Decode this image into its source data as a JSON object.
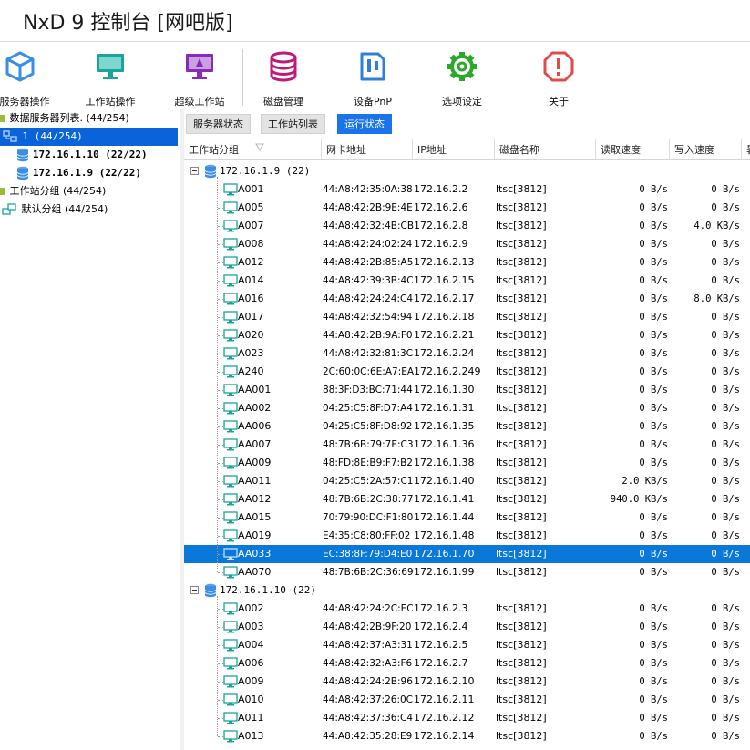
{
  "app": {
    "title": "NxD 9 控制台 [网吧版]"
  },
  "toolbar": {
    "server_ops": "服务器操作",
    "workstation_ops": "工作站操作",
    "super_workstation": "超级工作站",
    "disk_mgmt": "磁盘管理",
    "device_pnp": "设备PnP",
    "options": "选项设定",
    "about": "关于"
  },
  "left_tree": {
    "server_list": "数据服务器列表. (44/254)",
    "group1": "1 (44/254)",
    "server_a": "172.16.1.10 (22/22)",
    "server_b": "172.16.1.9 (22/22)",
    "ws_groups": "工作站分组 (44/254)",
    "default_group": "默认分组 (44/254)"
  },
  "tabs": {
    "server_status": "服务器状态",
    "ws_list": "工作站列表",
    "run_status": "运行状态"
  },
  "grid": {
    "columns": {
      "group": "工作站分组",
      "mac": "网卡地址",
      "ip": "IP地址",
      "disk": "磁盘名称",
      "read": "读取速度",
      "write": "写入速度",
      "extra": "暑"
    },
    "group1_label": "172.16.1.9 (22)",
    "group2_label": "172.16.1.10 (22)",
    "group1_rows": [
      {
        "name": "A001",
        "mac": "44:A8:42:35:0A:38",
        "ip": "172.16.2.2",
        "disk": "ltsc[3812]",
        "read": "0 B/s",
        "write": "0 B/s"
      },
      {
        "name": "A005",
        "mac": "44:A8:42:2B:9E:4E",
        "ip": "172.16.2.6",
        "disk": "ltsc[3812]",
        "read": "0 B/s",
        "write": "0 B/s"
      },
      {
        "name": "A007",
        "mac": "44:A8:42:32:4B:CB",
        "ip": "172.16.2.8",
        "disk": "ltsc[3812]",
        "read": "0 B/s",
        "write": "4.0 KB/s"
      },
      {
        "name": "A008",
        "mac": "44:A8:42:24:02:24",
        "ip": "172.16.2.9",
        "disk": "ltsc[3812]",
        "read": "0 B/s",
        "write": "0 B/s"
      },
      {
        "name": "A012",
        "mac": "44:A8:42:2B:85:A5",
        "ip": "172.16.2.13",
        "disk": "ltsc[3812]",
        "read": "0 B/s",
        "write": "0 B/s"
      },
      {
        "name": "A014",
        "mac": "44:A8:42:39:3B:4C",
        "ip": "172.16.2.15",
        "disk": "ltsc[3812]",
        "read": "0 B/s",
        "write": "0 B/s"
      },
      {
        "name": "A016",
        "mac": "44:A8:42:24:24:C4",
        "ip": "172.16.2.17",
        "disk": "ltsc[3812]",
        "read": "0 B/s",
        "write": "8.0 KB/s"
      },
      {
        "name": "A017",
        "mac": "44:A8:42:32:54:94",
        "ip": "172.16.2.18",
        "disk": "ltsc[3812]",
        "read": "0 B/s",
        "write": "0 B/s"
      },
      {
        "name": "A020",
        "mac": "44:A8:42:2B:9A:F0",
        "ip": "172.16.2.21",
        "disk": "ltsc[3812]",
        "read": "0 B/s",
        "write": "0 B/s"
      },
      {
        "name": "A023",
        "mac": "44:A8:42:32:81:3C",
        "ip": "172.16.2.24",
        "disk": "ltsc[3812]",
        "read": "0 B/s",
        "write": "0 B/s"
      },
      {
        "name": "A240",
        "mac": "2C:60:0C:6E:A7:EA",
        "ip": "172.16.2.249",
        "disk": "ltsc[3812]",
        "read": "0 B/s",
        "write": "0 B/s"
      },
      {
        "name": "AA001",
        "mac": "88:3F:D3:BC:71:44",
        "ip": "172.16.1.30",
        "disk": "ltsc[3812]",
        "read": "0 B/s",
        "write": "0 B/s"
      },
      {
        "name": "AA002",
        "mac": "04:25:C5:8F:D7:A4",
        "ip": "172.16.1.31",
        "disk": "ltsc[3812]",
        "read": "0 B/s",
        "write": "0 B/s"
      },
      {
        "name": "AA006",
        "mac": "04:25:C5:8F:D8:92",
        "ip": "172.16.1.35",
        "disk": "ltsc[3812]",
        "read": "0 B/s",
        "write": "0 B/s"
      },
      {
        "name": "AA007",
        "mac": "48:7B:6B:79:7E:C3",
        "ip": "172.16.1.36",
        "disk": "ltsc[3812]",
        "read": "0 B/s",
        "write": "0 B/s"
      },
      {
        "name": "AA009",
        "mac": "48:FD:8E:B9:F7:B2",
        "ip": "172.16.1.38",
        "disk": "ltsc[3812]",
        "read": "0 B/s",
        "write": "0 B/s"
      },
      {
        "name": "AA011",
        "mac": "04:25:C5:2A:57:C1",
        "ip": "172.16.1.40",
        "disk": "ltsc[3812]",
        "read": "2.0 KB/s",
        "write": "0 B/s"
      },
      {
        "name": "AA012",
        "mac": "48:7B:6B:2C:38:77",
        "ip": "172.16.1.41",
        "disk": "ltsc[3812]",
        "read": "940.0 KB/s",
        "write": "0 B/s"
      },
      {
        "name": "AA015",
        "mac": "70:79:90:DC:F1:80",
        "ip": "172.16.1.44",
        "disk": "ltsc[3812]",
        "read": "0 B/s",
        "write": "0 B/s"
      },
      {
        "name": "AA019",
        "mac": "E4:35:C8:80:FF:02",
        "ip": "172.16.1.48",
        "disk": "ltsc[3812]",
        "read": "0 B/s",
        "write": "0 B/s"
      },
      {
        "name": "AA033",
        "mac": "EC:38:8F:79:D4:E0",
        "ip": "172.16.1.70",
        "disk": "ltsc[3812]",
        "read": "0 B/s",
        "write": "0 B/s",
        "selected": true
      },
      {
        "name": "AA070",
        "mac": "48:7B:6B:2C:36:69",
        "ip": "172.16.1.99",
        "disk": "ltsc[3812]",
        "read": "0 B/s",
        "write": "0 B/s"
      }
    ],
    "group2_rows": [
      {
        "name": "A002",
        "mac": "44:A8:42:24:2C:EC",
        "ip": "172.16.2.3",
        "disk": "ltsc[3812]",
        "read": "0 B/s",
        "write": "0 B/s"
      },
      {
        "name": "A003",
        "mac": "44:A8:42:2B:9F:20",
        "ip": "172.16.2.4",
        "disk": "ltsc[3812]",
        "read": "0 B/s",
        "write": "0 B/s"
      },
      {
        "name": "A004",
        "mac": "44:A8:42:37:A3:31",
        "ip": "172.16.2.5",
        "disk": "ltsc[3812]",
        "read": "0 B/s",
        "write": "0 B/s"
      },
      {
        "name": "A006",
        "mac": "44:A8:42:32:A3:F6",
        "ip": "172.16.2.7",
        "disk": "ltsc[3812]",
        "read": "0 B/s",
        "write": "0 B/s"
      },
      {
        "name": "A009",
        "mac": "44:A8:42:24:2B:96",
        "ip": "172.16.2.10",
        "disk": "ltsc[3812]",
        "read": "0 B/s",
        "write": "0 B/s"
      },
      {
        "name": "A010",
        "mac": "44:A8:42:37:26:0C",
        "ip": "172.16.2.11",
        "disk": "ltsc[3812]",
        "read": "0 B/s",
        "write": "0 B/s"
      },
      {
        "name": "A011",
        "mac": "44:A8:42:37:36:C4",
        "ip": "172.16.2.12",
        "disk": "ltsc[3812]",
        "read": "0 B/s",
        "write": "0 B/s"
      },
      {
        "name": "A013",
        "mac": "44:A8:42:35:28:E9",
        "ip": "172.16.2.14",
        "disk": "ltsc[3812]",
        "read": "0 B/s",
        "write": "0 B/s"
      }
    ]
  },
  "colors": {
    "selection": "#0a78d8",
    "active_tab": "#1a73e8",
    "server_icon": "#3a8ee6",
    "workstation_icon": "#19a59a",
    "super_icon": "#8a2ab8",
    "disk_icon": "#c2187a",
    "pnp_icon": "#2f7fd8",
    "options_icon": "#2aa82a",
    "about_icon": "#e24a4a"
  },
  "icons": {
    "server": "cube-icon",
    "workstation": "monitor-icon",
    "super": "super-monitor-icon",
    "disk": "database-icon",
    "pnp": "device-icon",
    "options": "gear-icon",
    "about": "info-icon"
  }
}
